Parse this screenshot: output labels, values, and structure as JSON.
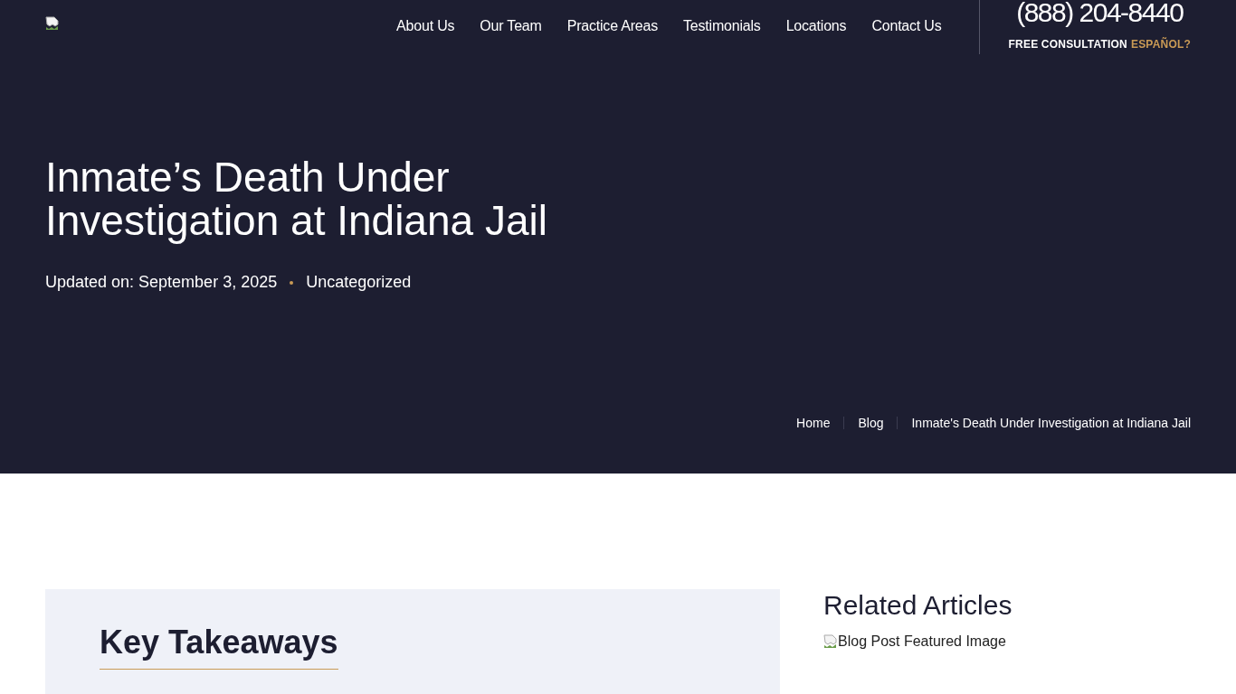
{
  "header": {
    "logo": {
      "kind": "broken-image"
    },
    "nav": [
      "About Us",
      "Our Team",
      "Practice Areas",
      "Testimonials",
      "Locations",
      "Contact Us"
    ],
    "phone": "(888) 204-8440",
    "consultation": "FREE CONSULTATION",
    "language_link": "ESPAÑOL?"
  },
  "hero": {
    "title": "Inmate’s Death Under Investigation at Indiana Jail",
    "updated": "Updated on: September 3, 2025",
    "category": "Uncategorized",
    "breadcrumbs": [
      "Home",
      "Blog",
      "Inmate's Death Under Investigation at Indiana Jail"
    ]
  },
  "key_takeaways": {
    "heading": "Key Takeaways"
  },
  "sidebar": {
    "heading": "Related Articles",
    "image_alt": "Blog Post Featured Image"
  }
}
